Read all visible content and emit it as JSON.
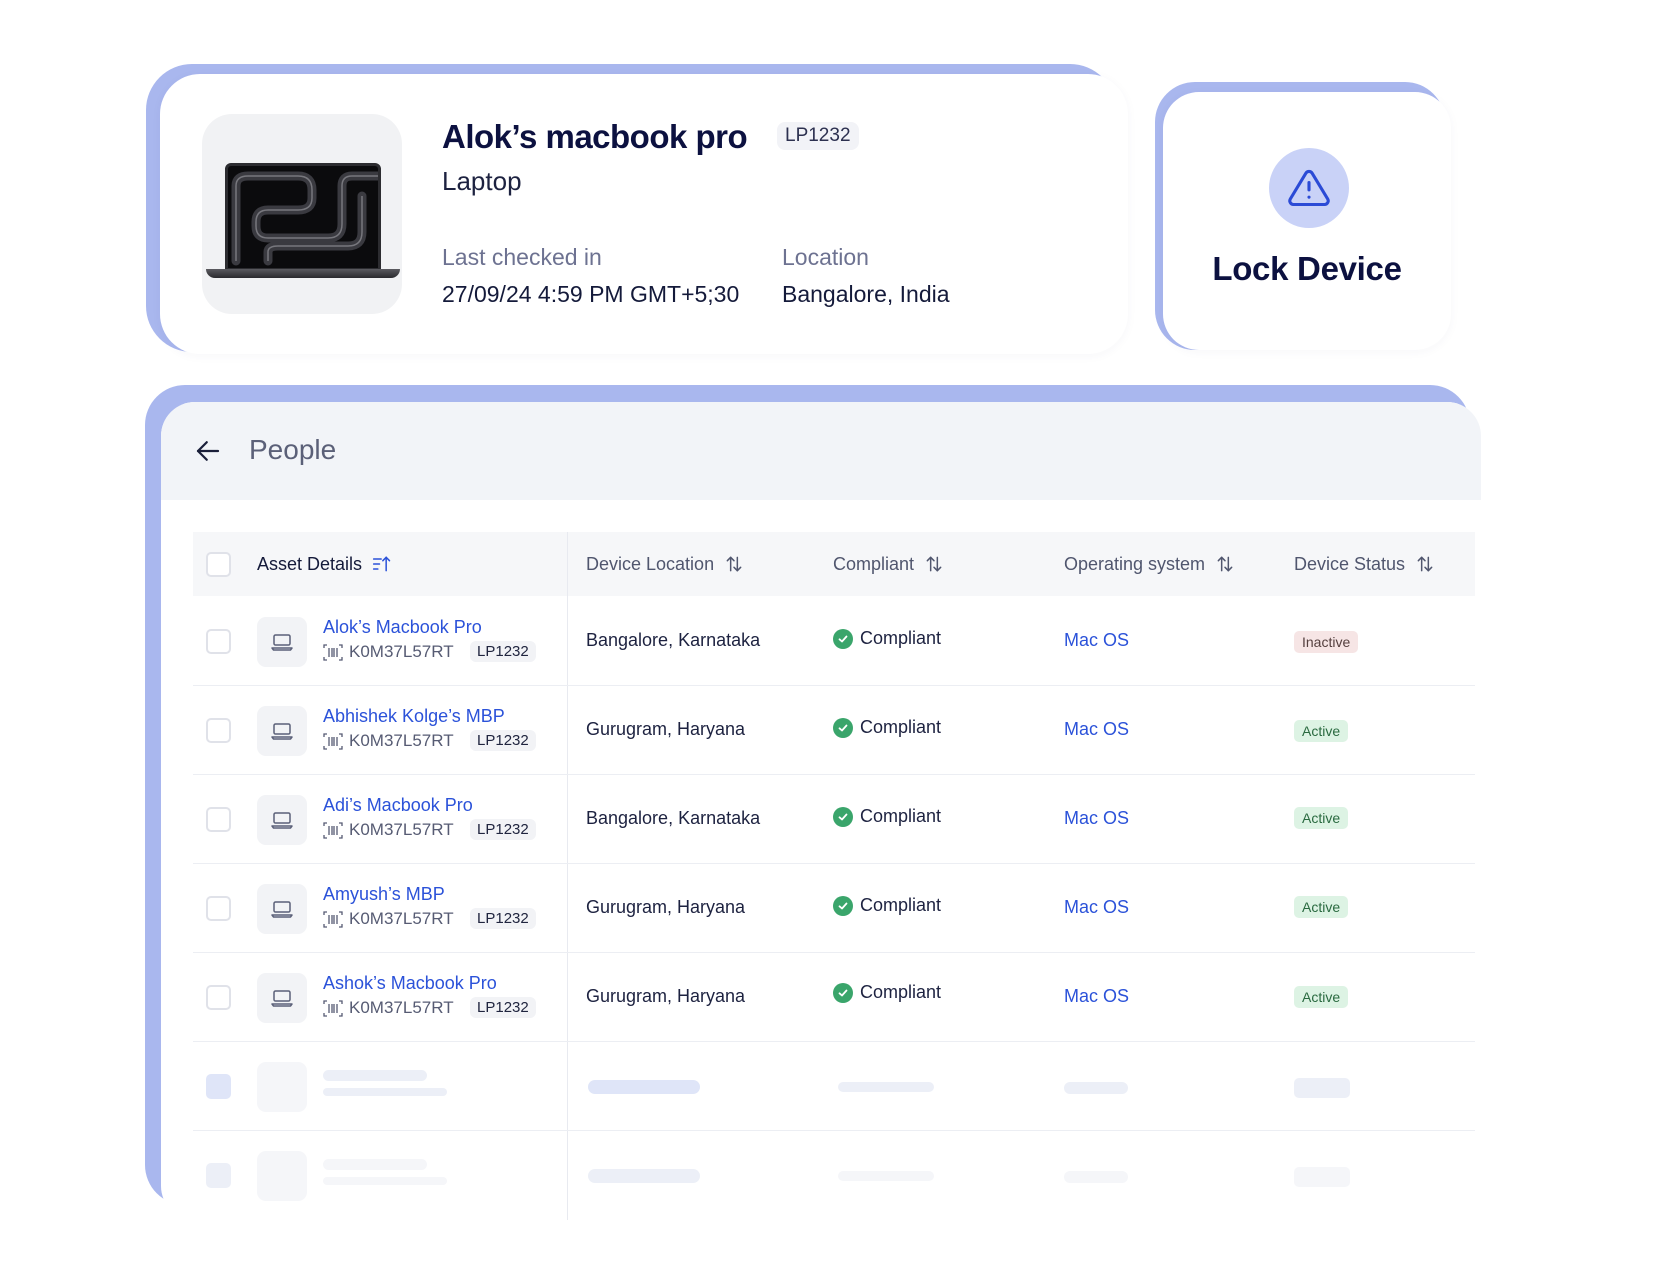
{
  "device": {
    "title": "Alok’s macbook pro",
    "tag": "LP1232",
    "type": "Laptop",
    "last_checked_label": "Last checked in",
    "last_checked_value": "27/09/24 4:59 PM GMT+5;30",
    "location_label": "Location",
    "location_value": "Bangalore, India",
    "thumbnail_icon": "laptop-image"
  },
  "lock": {
    "label": "Lock Device",
    "icon": "warning-triangle-icon",
    "icon_bg": "#c9d2f7",
    "icon_color": "#2b4bd6"
  },
  "panel": {
    "title": "People",
    "back_icon": "arrow-left-icon"
  },
  "table": {
    "columns": [
      {
        "label": "Asset Details",
        "sort_icon": "sort-ascending-icon"
      },
      {
        "label": "Device Location",
        "sort_icon": "sort-icon"
      },
      {
        "label": "Compliant",
        "sort_icon": "sort-icon"
      },
      {
        "label": "Operating system",
        "sort_icon": "sort-icon"
      },
      {
        "label": "Device Status",
        "sort_icon": "sort-icon"
      }
    ],
    "rows": [
      {
        "name": "Alok’s Macbook Pro",
        "serial": "K0M37L57RT",
        "tag": "LP1232",
        "location": "Bangalore, Karnataka",
        "compliant": "Compliant",
        "os": "Mac OS",
        "status": "Inactive"
      },
      {
        "name": "Abhishek Kolge’s MBP",
        "serial": "K0M37L57RT",
        "tag": "LP1232",
        "location": "Gurugram, Haryana",
        "compliant": "Compliant",
        "os": "Mac OS",
        "status": "Active"
      },
      {
        "name": "Adi’s Macbook Pro",
        "serial": "K0M37L57RT",
        "tag": "LP1232",
        "location": "Bangalore, Karnataka",
        "compliant": "Compliant",
        "os": "Mac OS",
        "status": "Active"
      },
      {
        "name": "Amyush’s MBP",
        "serial": "K0M37L57RT",
        "tag": "LP1232",
        "location": "Gurugram, Haryana",
        "compliant": "Compliant",
        "os": "Mac OS",
        "status": "Active"
      },
      {
        "name": "Ashok’s Macbook Pro",
        "serial": "K0M37L57RT",
        "tag": "LP1232",
        "location": "Gurugram, Haryana",
        "compliant": "Compliant",
        "os": "Mac OS",
        "status": "Active"
      }
    ],
    "loading_rows": 2
  },
  "colors": {
    "accent_blue": "#2b52d9",
    "frame_blue": "#a9b7ee",
    "compliant_green": "#3aa56b",
    "active_badge_bg": "#ddf3e4",
    "inactive_badge_bg": "#f6e5e5"
  }
}
